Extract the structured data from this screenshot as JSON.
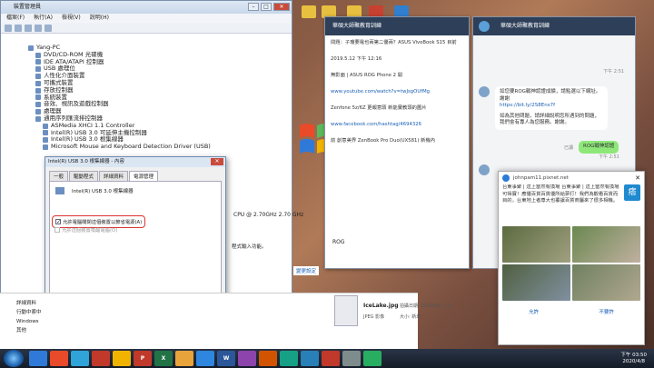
{
  "desktop": {
    "icons": [
      {
        "label": "Yang",
        "color": "#e8c040"
      },
      {
        "label": "",
        "color": "#e8c040"
      },
      {
        "label": "",
        "color": "#e8c040"
      },
      {
        "label": "",
        "color": "#e8c040"
      },
      {
        "label": "",
        "color": "#c84030"
      },
      {
        "label": "",
        "color": "#3080d0"
      }
    ]
  },
  "device_manager": {
    "title": "裝置管理員",
    "menu": [
      "檔案(F)",
      "執行(A)",
      "檢視(V)",
      "說明(H)"
    ],
    "tree": [
      {
        "label": "Yang-PC",
        "level": 0
      },
      {
        "label": "DVD/CD-ROM 光碟機",
        "level": 1
      },
      {
        "label": "IDE ATA/ATAPI 控制器",
        "level": 1
      },
      {
        "label": "USB 處理位",
        "level": 1
      },
      {
        "label": "人性化介面裝置",
        "level": 1
      },
      {
        "label": "可攜式裝置",
        "level": 1
      },
      {
        "label": "存放控制器",
        "level": 1
      },
      {
        "label": "系統裝置",
        "level": 1
      },
      {
        "label": "音效、視訊及遊戲控制器",
        "level": 1
      },
      {
        "label": "處理器",
        "level": 1
      },
      {
        "label": "通用序列匯流排控制器",
        "level": 1
      },
      {
        "label": "ASMedia XHCI 1.1 Controller",
        "level": 2
      },
      {
        "label": "Intel(R) USB 3.0 可延伸主機控制器",
        "level": 2
      },
      {
        "label": "Intel(R) USB 3.0 根集線器",
        "level": 2
      },
      {
        "label": "Microsoft Mouse and Keyboard Detection Driver (USB)",
        "level": 2
      }
    ],
    "cpu_text": "CPU @ 2.70GHz   2.70 GHz",
    "settings_text": "程式輸入功能。",
    "change_settings": "變更設定"
  },
  "prop_dialog": {
    "title": "Intel(R) USB 3.0 根集線器 - 內容",
    "tabs": [
      "一般",
      "驅動程式",
      "詳細資料",
      "電源管理"
    ],
    "active_tab": "電源管理",
    "device_name": "Intel(R) USB 3.0 根集線器",
    "opt1": "允許電腦關閉這個裝置以節省電源(A)",
    "opt1_checked": true,
    "opt2": "允許這個裝置喚醒電腦(O)",
    "opt2_checked": false,
    "ok": "確定",
    "cancel": "取消"
  },
  "chat": {
    "title": "華碩大師聚教育訓練",
    "messages": [
      "問題：子瓊要電也兩第二優兩？ASUS VivoBook S15 目前",
      "2019.5.12 下午 12:16",
      "無影面 | ASUS ROG Phone 2 開",
      "www.youtube.com/watch?v=twJsgOUfMg",
      "Zenfone 5z/6Z 更報意頭 新能實教頭的圖片",
      "www.facebook.com/hashtag/4694326",
      "前 創意美界 ZenBook Pro Duo(UX581) 新機內"
    ],
    "rog": "ROG"
  },
  "right_chat": {
    "title": "華碩大師聚教育訓練",
    "time1": "下午 2:51",
    "msg1": "如您要ROG戰神認證成績，請點選以下網址。謝謝",
    "link1": "https://bit.ly/2S8Ens7f",
    "msg2": "如為其他問題，請詳細說明您所遇到的問題，我們會有專人為您服務。謝謝。",
    "time2": "下午 2:51",
    "read": "已讀",
    "me1": "ROG戰神認證",
    "time3": "下午 2:51"
  },
  "notification": {
    "sender": "johnpam11.pixnet.net",
    "body": "台東事聚 | 這上當然有換場 台東事聚 | 這上當然有換場可得寶！應優百貨百貨優所給夢打！我們為觀看百貨而目的，台東地上者尊大也覆讓百貨商屬來了很多相機。",
    "accept": "允許",
    "decline": "不要許"
  },
  "explorer": {
    "items": [
      "詳細資料",
      "行動中索中",
      "Windows",
      "其他"
    ],
    "file_name": "IceLake.jpg",
    "file_type": "JPEG 影像",
    "taken": "拍攝日期: 2020/4/8 上午",
    "size": "大小: 新增"
  },
  "taskbar": {
    "apps": [
      {
        "label": "",
        "color": "#2f7ad8"
      },
      {
        "label": "",
        "color": "#e84a2a"
      },
      {
        "label": "",
        "color": "#2fa4d8"
      },
      {
        "label": "",
        "color": "#c0392b"
      },
      {
        "label": "",
        "color": "#f0b400"
      },
      {
        "label": "P",
        "color": "#c0392b"
      },
      {
        "label": "X",
        "color": "#217346"
      },
      {
        "label": "",
        "color": "#e8a33a"
      },
      {
        "label": "",
        "color": "#2e86de"
      },
      {
        "label": "W",
        "color": "#2b579a"
      },
      {
        "label": "",
        "color": "#8e44ad"
      },
      {
        "label": "",
        "color": "#d35400"
      },
      {
        "label": "",
        "color": "#16a085"
      },
      {
        "label": "",
        "color": "#2980b9"
      },
      {
        "label": "",
        "color": "#c0392b"
      },
      {
        "label": "",
        "color": "#7f8c8d"
      },
      {
        "label": "",
        "color": "#27ae60"
      }
    ],
    "time": "下午 03:50",
    "date": "2020/4/8"
  }
}
